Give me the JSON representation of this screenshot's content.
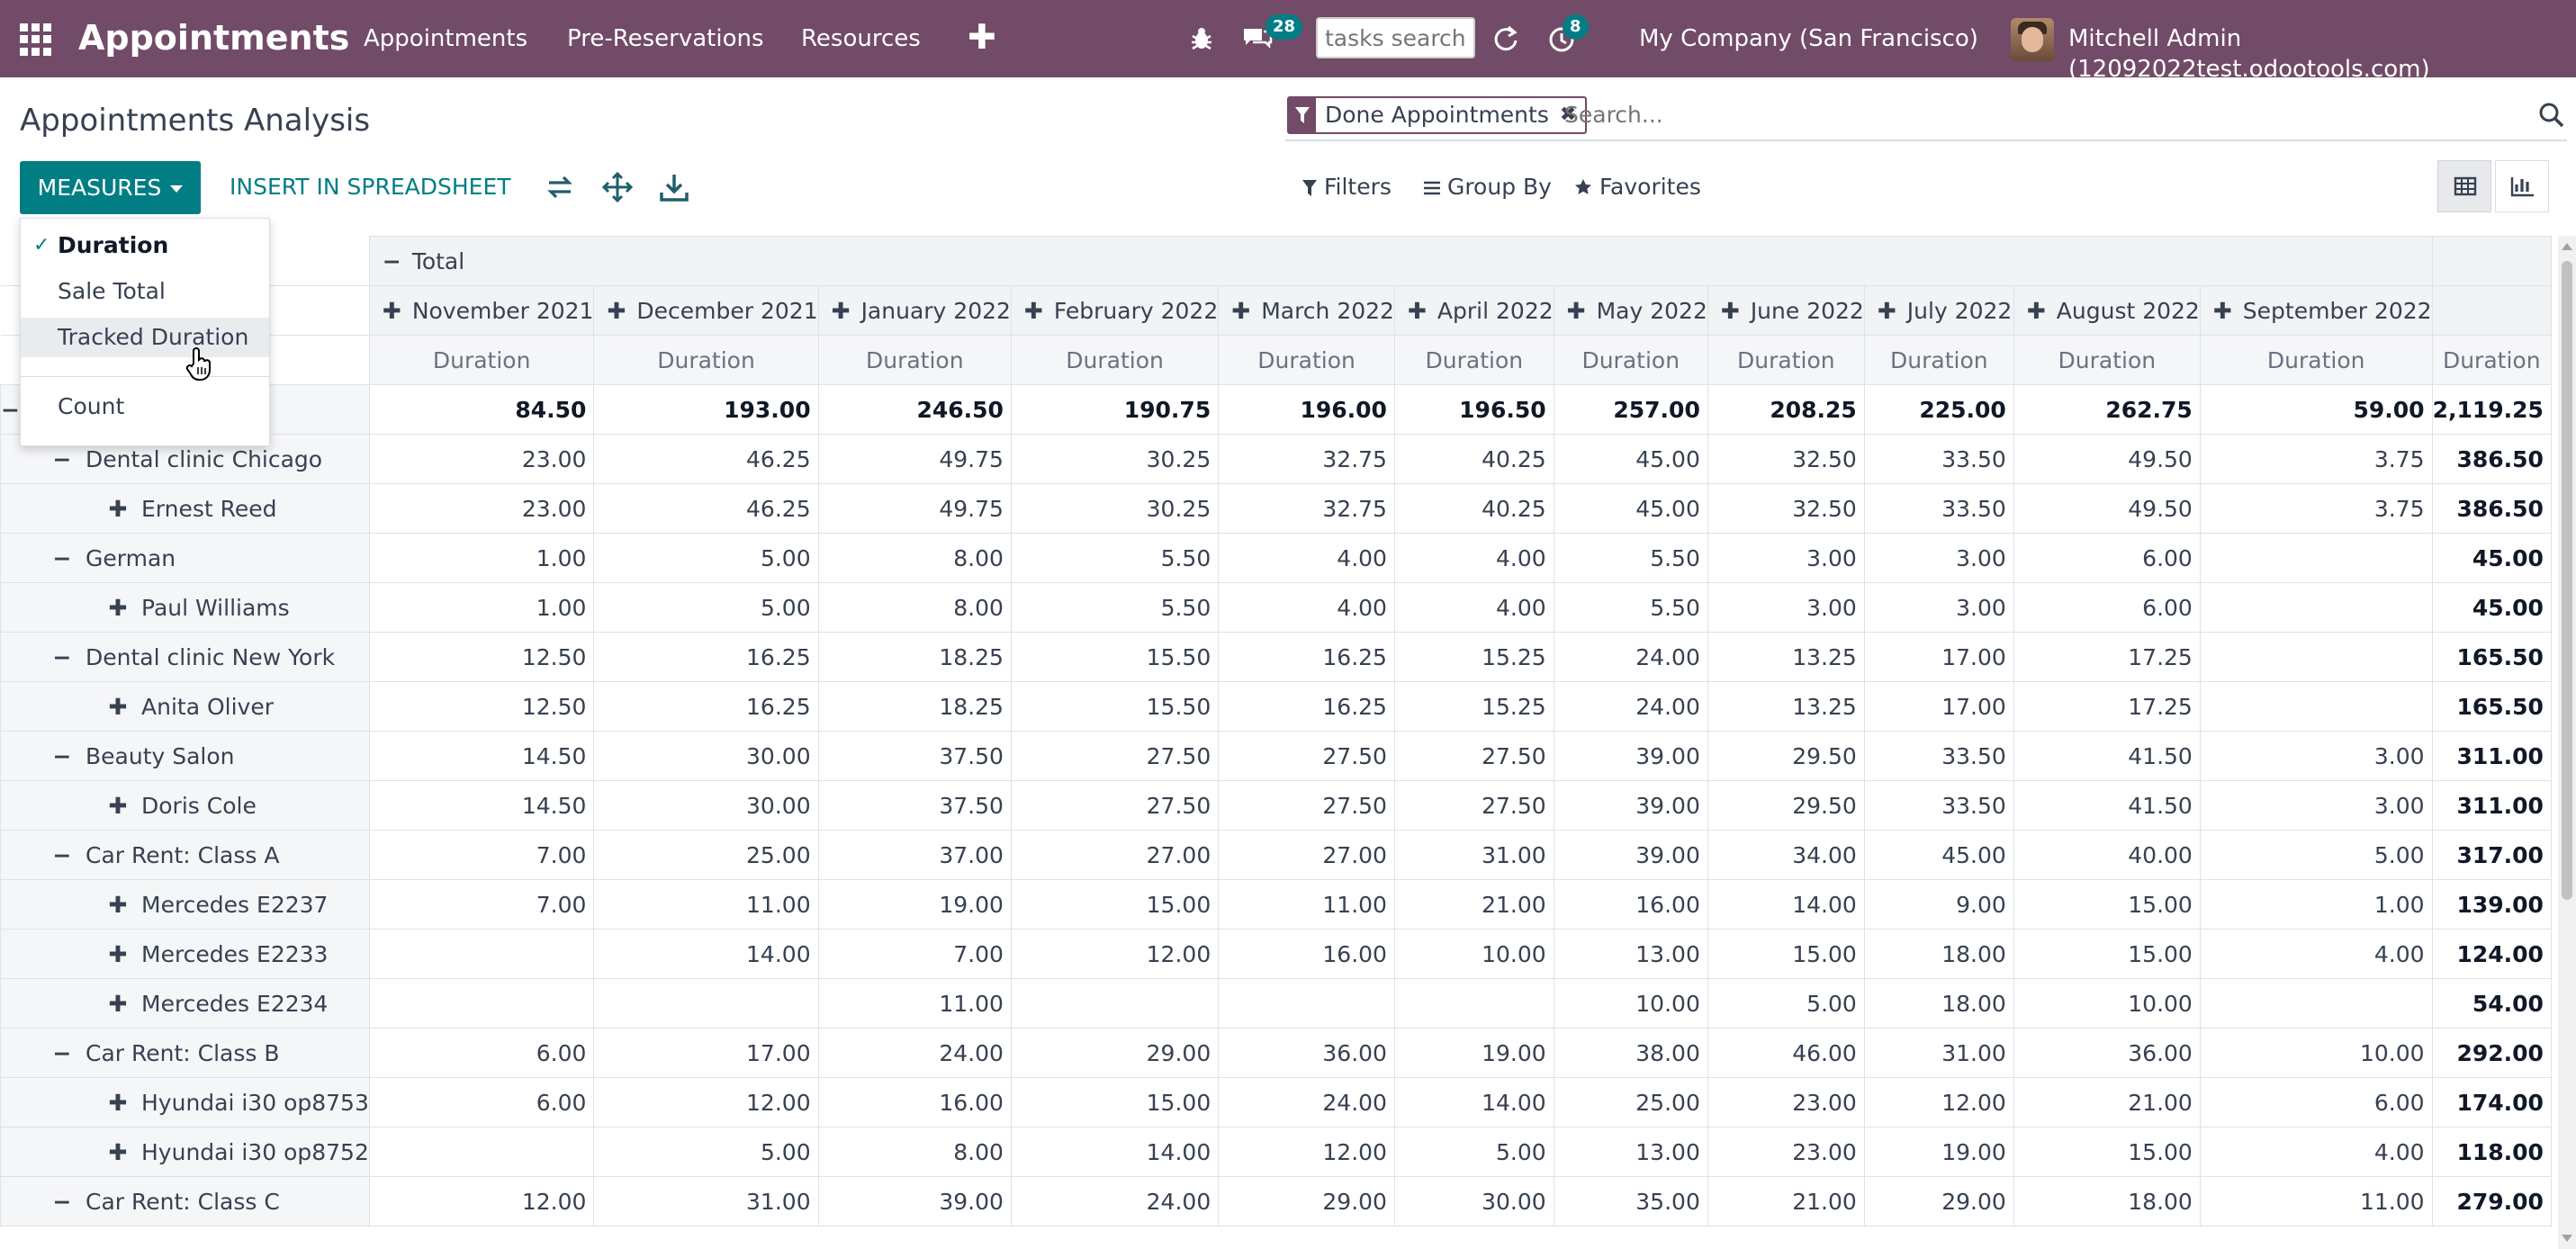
{
  "navbar": {
    "brand": "Appointments",
    "menu": [
      "Appointments",
      "Pre-Reservations",
      "Resources"
    ],
    "plus": "✚",
    "messages_badge": "28",
    "activities_badge": "8",
    "search_placeholder": "tasks search",
    "company": "My Company (San Francisco)",
    "user": "Mitchell Admin (12092022test.odootools.com)",
    "icons": [
      "apps-icon",
      "bug-icon",
      "chat-icon",
      "refresh-icon",
      "clock-icon"
    ]
  },
  "control_panel": {
    "title": "Appointments Analysis",
    "facet": "Done Appointments",
    "search_placeholder": "Search...",
    "measures_label": "MEASURES",
    "spreadsheet_label": "INSERT IN SPREADSHEET",
    "filters_label": "Filters",
    "groupby_label": "Group By",
    "favorites_label": "Favorites",
    "active_view": "pivot"
  },
  "measures_menu": {
    "items": [
      {
        "label": "Duration",
        "checked": true
      },
      {
        "label": "Sale Total",
        "checked": false
      },
      {
        "label": "Tracked Duration",
        "checked": false,
        "hovered": true
      },
      {
        "label": "Count",
        "checked": false
      }
    ]
  },
  "pivot": {
    "total_header": "Total",
    "measure": "Duration",
    "months": [
      "November 2021",
      "December 2021",
      "January 2022",
      "February 2022",
      "March 2022",
      "April 2022",
      "May 2022",
      "June 2022",
      "July 2022",
      "August 2022",
      "September 2022"
    ],
    "grand_total": {
      "values": [
        "84.50",
        "193.00",
        "246.50",
        "190.75",
        "196.00",
        "196.50",
        "257.00",
        "208.25",
        "225.00",
        "262.75",
        "59.00"
      ],
      "total": "2,119.25"
    },
    "rows": [
      {
        "label": "Dental clinic Chicago",
        "level": 1,
        "expanded": true,
        "values": [
          "23.00",
          "46.25",
          "49.75",
          "30.25",
          "32.75",
          "40.25",
          "45.00",
          "32.50",
          "33.50",
          "49.50",
          "3.75"
        ],
        "total": "386.50"
      },
      {
        "label": "Ernest Reed",
        "level": 2,
        "expanded": false,
        "values": [
          "23.00",
          "46.25",
          "49.75",
          "30.25",
          "32.75",
          "40.25",
          "45.00",
          "32.50",
          "33.50",
          "49.50",
          "3.75"
        ],
        "total": "386.50"
      },
      {
        "label": "German",
        "level": 1,
        "expanded": true,
        "values": [
          "1.00",
          "5.00",
          "8.00",
          "5.50",
          "4.00",
          "4.00",
          "5.50",
          "3.00",
          "3.00",
          "6.00",
          ""
        ],
        "total": "45.00"
      },
      {
        "label": "Paul Williams",
        "level": 2,
        "expanded": false,
        "values": [
          "1.00",
          "5.00",
          "8.00",
          "5.50",
          "4.00",
          "4.00",
          "5.50",
          "3.00",
          "3.00",
          "6.00",
          ""
        ],
        "total": "45.00"
      },
      {
        "label": "Dental clinic New York",
        "level": 1,
        "expanded": true,
        "values": [
          "12.50",
          "16.25",
          "18.25",
          "15.50",
          "16.25",
          "15.25",
          "24.00",
          "13.25",
          "17.00",
          "17.25",
          ""
        ],
        "total": "165.50"
      },
      {
        "label": "Anita Oliver",
        "level": 2,
        "expanded": false,
        "values": [
          "12.50",
          "16.25",
          "18.25",
          "15.50",
          "16.25",
          "15.25",
          "24.00",
          "13.25",
          "17.00",
          "17.25",
          ""
        ],
        "total": "165.50"
      },
      {
        "label": "Beauty Salon",
        "level": 1,
        "expanded": true,
        "values": [
          "14.50",
          "30.00",
          "37.50",
          "27.50",
          "27.50",
          "27.50",
          "39.00",
          "29.50",
          "33.50",
          "41.50",
          "3.00"
        ],
        "total": "311.00"
      },
      {
        "label": "Doris Cole",
        "level": 2,
        "expanded": false,
        "values": [
          "14.50",
          "30.00",
          "37.50",
          "27.50",
          "27.50",
          "27.50",
          "39.00",
          "29.50",
          "33.50",
          "41.50",
          "3.00"
        ],
        "total": "311.00"
      },
      {
        "label": "Car Rent: Class A",
        "level": 1,
        "expanded": true,
        "values": [
          "7.00",
          "25.00",
          "37.00",
          "27.00",
          "27.00",
          "31.00",
          "39.00",
          "34.00",
          "45.00",
          "40.00",
          "5.00"
        ],
        "total": "317.00"
      },
      {
        "label": "Mercedes E2237",
        "level": 2,
        "expanded": false,
        "values": [
          "7.00",
          "11.00",
          "19.00",
          "15.00",
          "11.00",
          "21.00",
          "16.00",
          "14.00",
          "9.00",
          "15.00",
          "1.00"
        ],
        "total": "139.00"
      },
      {
        "label": "Mercedes E2233",
        "level": 2,
        "expanded": false,
        "values": [
          "",
          "14.00",
          "7.00",
          "12.00",
          "16.00",
          "10.00",
          "13.00",
          "15.00",
          "18.00",
          "15.00",
          "4.00"
        ],
        "total": "124.00"
      },
      {
        "label": "Mercedes E2234",
        "level": 2,
        "expanded": false,
        "values": [
          "",
          "",
          "11.00",
          "",
          "",
          "",
          "10.00",
          "5.00",
          "18.00",
          "10.00",
          ""
        ],
        "total": "54.00"
      },
      {
        "label": "Car Rent: Class B",
        "level": 1,
        "expanded": true,
        "values": [
          "6.00",
          "17.00",
          "24.00",
          "29.00",
          "36.00",
          "19.00",
          "38.00",
          "46.00",
          "31.00",
          "36.00",
          "10.00"
        ],
        "total": "292.00"
      },
      {
        "label": "Hyundai i30 op8753",
        "level": 2,
        "expanded": false,
        "values": [
          "6.00",
          "12.00",
          "16.00",
          "15.00",
          "24.00",
          "14.00",
          "25.00",
          "23.00",
          "12.00",
          "21.00",
          "6.00"
        ],
        "total": "174.00"
      },
      {
        "label": "Hyundai i30 op8752",
        "level": 2,
        "expanded": false,
        "values": [
          "",
          "5.00",
          "8.00",
          "14.00",
          "12.00",
          "5.00",
          "13.00",
          "23.00",
          "19.00",
          "15.00",
          "4.00"
        ],
        "total": "118.00"
      },
      {
        "label": "Car Rent: Class C",
        "level": 1,
        "expanded": true,
        "values": [
          "12.00",
          "31.00",
          "39.00",
          "24.00",
          "29.00",
          "30.00",
          "35.00",
          "21.00",
          "29.00",
          "18.00",
          "11.00"
        ],
        "total": "279.00"
      }
    ]
  },
  "colors": {
    "navbar": "#714B67",
    "primary": "#017E84",
    "header_bg": "#f1f3f5",
    "border": "#dee2e6"
  }
}
